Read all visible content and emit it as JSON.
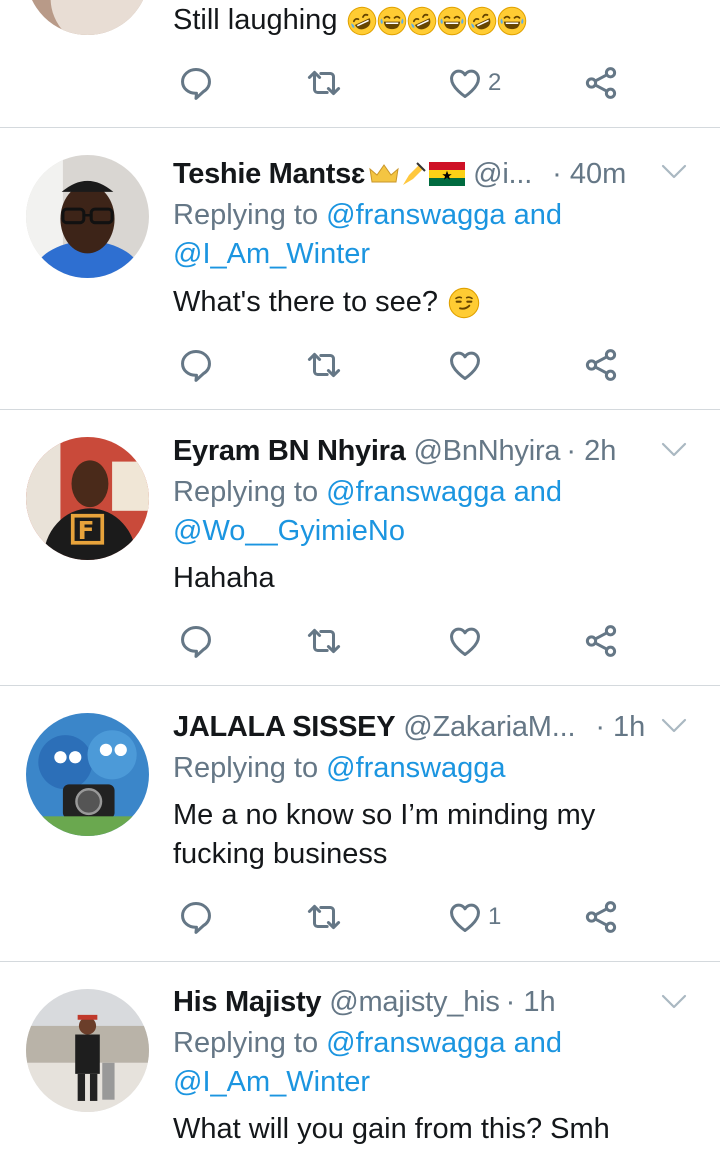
{
  "tweets": [
    {
      "text": "Still laughing",
      "emojis": [
        "rofl",
        "joy",
        "rofl",
        "joy",
        "rofl",
        "joy"
      ],
      "actions": {
        "reply_count": "",
        "retweet_count": "",
        "like_count": "2"
      }
    },
    {
      "name": "Teshie Mantsɛ",
      "name_emojis": [
        "crown",
        "writing-hand",
        "ghana-flag"
      ],
      "handle": "@i...",
      "time": "· 40m",
      "replying_prefix": "Replying to ",
      "replying_line1_mention": "@franswagga",
      "replying_line1_suffix": " and",
      "replying_line2_mention": "@I_Am_Winter",
      "text": "What's there to see?",
      "text_emoji": "smirk",
      "actions": {
        "reply_count": "",
        "retweet_count": "",
        "like_count": ""
      }
    },
    {
      "name": "Eyram BN Nhyira",
      "handle": "@BnNhyira",
      "time": "· 2h",
      "replying_prefix": "Replying to ",
      "replying_line1_mention": "@franswagga",
      "replying_line1_suffix": " and",
      "replying_line2_mention": "@Wo__GyimieNo",
      "text": "Hahaha",
      "actions": {
        "reply_count": "",
        "retweet_count": "",
        "like_count": ""
      }
    },
    {
      "name": "JALALA SISSEY",
      "handle": "@ZakariaM...",
      "time": "· 1h",
      "replying_prefix": "Replying to ",
      "replying_line1_mention": "@franswagga",
      "text_line1": "Me a no know so I’m minding my",
      "text_line2": "fucking business",
      "actions": {
        "reply_count": "",
        "retweet_count": "",
        "like_count": "1"
      }
    },
    {
      "name": "His Majisty",
      "handle": "@majisty_his",
      "time": "· 1h",
      "replying_prefix": "Replying to ",
      "replying_line1_mention": "@franswagga",
      "replying_line1_suffix": " and",
      "replying_line2_mention": "@I_Am_Winter",
      "text": "What will you gain from this? Smh"
    }
  ],
  "colors": {
    "link": "#1b95e0",
    "secondary": "#657786",
    "divider": "#d4d9dd"
  }
}
